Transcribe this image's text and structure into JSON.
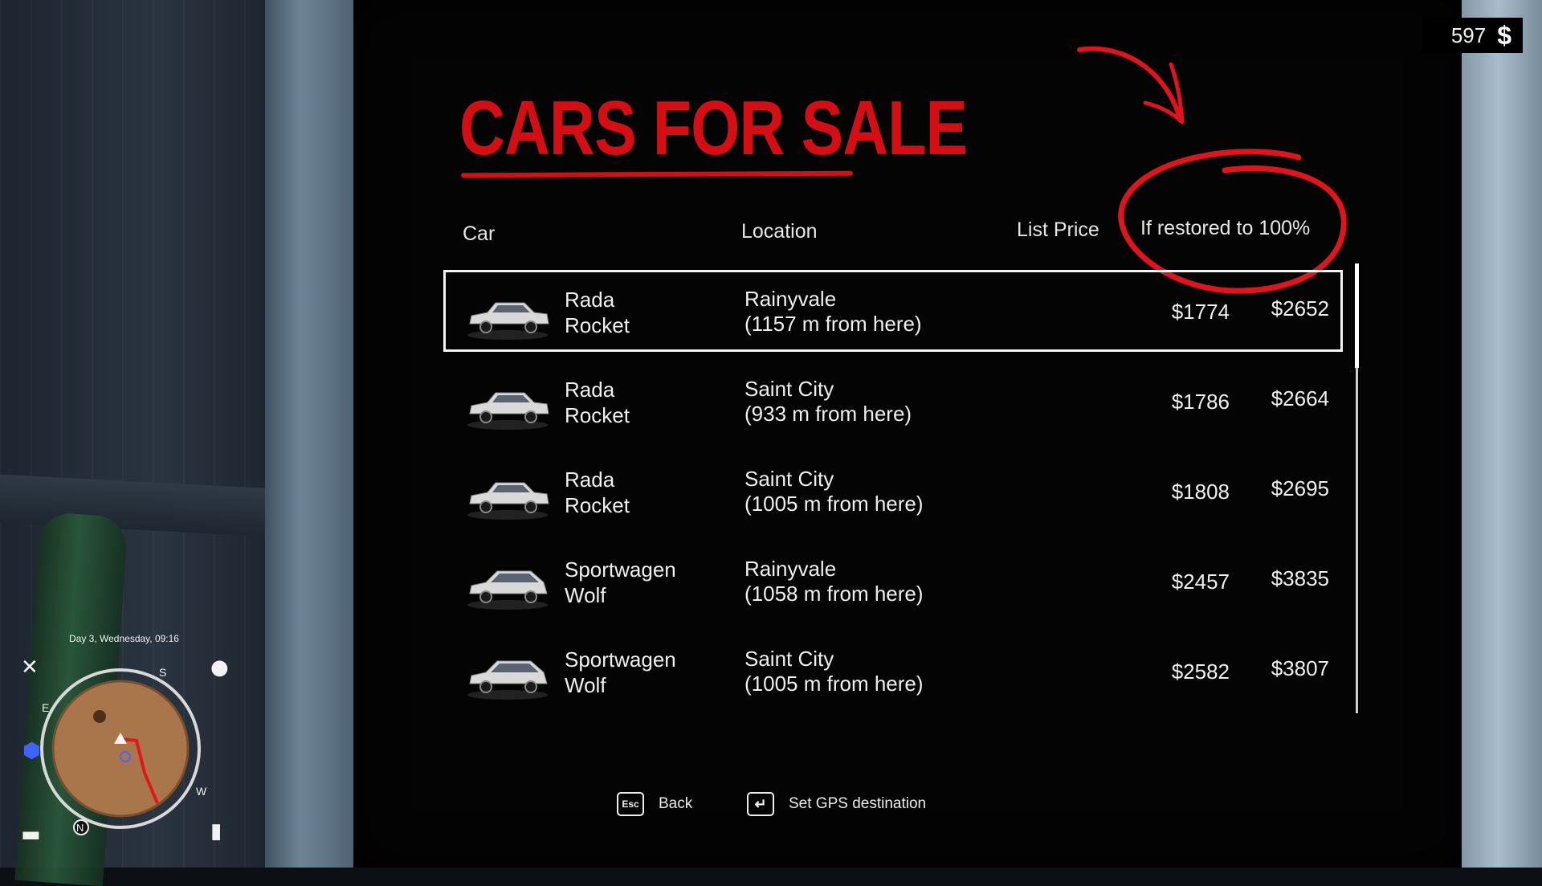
{
  "hud": {
    "money": "597",
    "money_icon": "dollar-icon",
    "date_time": "Day 3, Wednesday, 09:16",
    "compass": {
      "north": "N",
      "south": "S",
      "east": "E",
      "west": "W"
    },
    "icons": [
      "tools-icon",
      "water-drop-icon",
      "shield-icon",
      "bed-icon",
      "toilet-icon"
    ]
  },
  "title": "CARS FOR SALE",
  "columns": {
    "car": "Car",
    "location": "Location",
    "list_price": "List Price",
    "restored": "If restored to 100%"
  },
  "listings": [
    {
      "name_line1": "Rada",
      "name_line2": "Rocket",
      "loc_line1": "Rainyvale",
      "loc_line2": "(1157 m from here)",
      "price": "$1774",
      "restored": "$2652",
      "selected": true,
      "body": "sedan"
    },
    {
      "name_line1": "Rada",
      "name_line2": "Rocket",
      "loc_line1": "Saint City",
      "loc_line2": "(933 m from here)",
      "price": "$1786",
      "restored": "$2664",
      "selected": false,
      "body": "sedan"
    },
    {
      "name_line1": "Rada",
      "name_line2": "Rocket",
      "loc_line1": "Saint City",
      "loc_line2": "(1005 m from here)",
      "price": "$1808",
      "restored": "$2695",
      "selected": false,
      "body": "sedan"
    },
    {
      "name_line1": "Sportwagen",
      "name_line2": "Wolf",
      "loc_line1": "Rainyvale",
      "loc_line2": "(1058 m from here)",
      "price": "$2457",
      "restored": "$3835",
      "selected": false,
      "body": "hatch"
    },
    {
      "name_line1": "Sportwagen",
      "name_line2": "Wolf",
      "loc_line1": "Saint City",
      "loc_line2": "(1005 m from here)",
      "price": "$2582",
      "restored": "$3807",
      "selected": false,
      "body": "hatch"
    }
  ],
  "footer": {
    "back_key": "Esc",
    "back_label": "Back",
    "gps_key": "↵",
    "gps_label": "Set GPS destination"
  },
  "colors": {
    "title_red": "#d40e12",
    "annotation_red": "#e0141a",
    "panel_bg": "#040404"
  }
}
